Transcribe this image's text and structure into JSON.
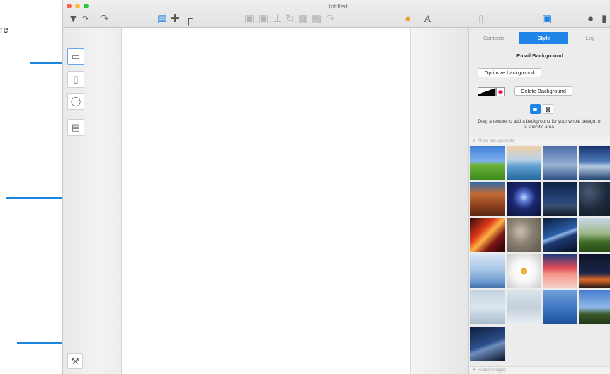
{
  "page_fragment": "re",
  "window": {
    "title": "Untitled"
  },
  "toolbar": {
    "icons": [
      "pointer-tool-icon",
      "text-path-icon",
      "redo-icon",
      "layout-blocks-icon",
      "crosshair-icon",
      "corner-icon",
      "bring-forward-icon",
      "send-backward-icon",
      "align-icon",
      "rotate-icon",
      "image-icon",
      "replace-image-icon",
      "text-effect-icon",
      "color-palette-icon",
      "font-icon",
      "document-icon",
      "window-icon",
      "pen-icon"
    ]
  },
  "left_tools": [
    "desktop-layout-icon",
    "phone-layout-icon",
    "mouse-icon",
    "template-icon"
  ],
  "bottom_tool": "hammer-icon",
  "panel": {
    "tabs": [
      "Contents",
      "Style",
      "Log"
    ],
    "active_tab": "Style",
    "title": "Email Background",
    "optimize_label": "Optimize background",
    "delete_label": "Delete Background",
    "hint": "Drag a texture to add a background for your whole design, or a specific area.",
    "photo_section": "Photo backgrounds",
    "header_section": "Header images"
  },
  "colors": {
    "accent": "#1f84e8",
    "callout": "#1a86e0"
  },
  "photos": [
    {
      "name": "green-hill-photo",
      "bg": "linear-gradient(#3f7fd6 0%,#7fb0ee 45%,#6fb33b 55%,#3a8a1d 100%)"
    },
    {
      "name": "sea-horizon-photo",
      "bg": "linear-gradient(#f1cfa6 0%,#b9d2e8 40%,#5f9fd0 60%,#24679f 100%)"
    },
    {
      "name": "blue-sea-photo",
      "bg": "linear-gradient(#4f6ea8 0%,#8fa8d0 50%,#9cb4d4 55%,#2e4f85 100%)"
    },
    {
      "name": "mountain-cloud-photo",
      "bg": "linear-gradient(#17356f 0%,#4b78b6 45%,#b7cbe4 60%,#20406f 100%)"
    },
    {
      "name": "canyon-hoodoo-photo",
      "bg": "linear-gradient(#2e6aa8 0%,#c36a35 35%,#8c3f1d 70%,#5a2812 100%)"
    },
    {
      "name": "fireworks-photo",
      "bg": "radial-gradient(circle at 50% 45%,#c7dcff 0,#5d77d8 18%,#1b2870 45%,#0a1236 100%)"
    },
    {
      "name": "night-mountain-photo",
      "bg": "linear-gradient(#0e2346 0%,#25467a 55%,#3a4f6d 70%,#0e1a2e 100%)"
    },
    {
      "name": "starry-sky-photo",
      "bg": "radial-gradient(circle at 30% 30%,#4a5a74 0,#1f2a3c 50%,#111722 100%)"
    },
    {
      "name": "city-lights-photo",
      "bg": "linear-gradient(135deg,#3a0a0a 0%,#e03b1b 35%,#ffb347 50%,#7a1414 70%,#1a0606 100%)"
    },
    {
      "name": "pebbles-photo",
      "bg": "radial-gradient(circle at 40% 40%,#c9c1b3 0,#8c8275 40%,#5b534a 100%)"
    },
    {
      "name": "milky-way-photo",
      "bg": "linear-gradient(160deg,#0a1b3a 0%,#2b5fa8 45%,#8fb6e6 50%,#1c3b73 60%,#050d1f 100%)"
    },
    {
      "name": "wildflower-photo",
      "bg": "linear-gradient(#c7d6e8 0%,#9fb88a 45%,#3d6b24 70%,#2a4a18 100%)"
    },
    {
      "name": "boat-mist-photo",
      "bg": "linear-gradient(#d6e6f5 0%,#a8c6e6 45%,#6f9bd0 80%,#3f6ea8 100%)"
    },
    {
      "name": "daisy-photo",
      "bg": "radial-gradient(circle at 50% 50%,#f4c542 0,#e8a52a 12%,#ffffff 14%,#f7f7f7 45%,#c8c8c8 100%)"
    },
    {
      "name": "pink-sunset-photo",
      "bg": "linear-gradient(#1f3a78 0%,#e24c5a 40%,#f39a8a 60%,#f6d1c8 100%)"
    },
    {
      "name": "dusk-horizon-photo",
      "bg": "linear-gradient(#0c1326 0%,#1c2548 55%,#e26b2b 75%,#1a1414 100%)"
    },
    {
      "name": "fog-horizon-photo",
      "bg": "linear-gradient(#c6d4e2 0%,#dbe5ee 50%,#a7bbcd 100%)"
    },
    {
      "name": "frosted-trees-photo",
      "bg": "linear-gradient(#dbe3ea 0%,#c3d0dc 50%,#e9eef3 100%)"
    },
    {
      "name": "ocean-waves-photo",
      "bg": "linear-gradient(#6f9fd8 0%,#3f78c4 50%,#1e4f9a 100%)"
    },
    {
      "name": "palm-trees-photo",
      "bg": "linear-gradient(#4a7fd0 0%,#8fb8e8 50%,#3a5a2a 70%,#1f3518 100%)"
    },
    {
      "name": "night-sky-photo",
      "bg": "linear-gradient(160deg,#0c1c3a 0%,#2b4f8c 50%,#6f8fbf 60%,#0a142a 100%)"
    }
  ]
}
